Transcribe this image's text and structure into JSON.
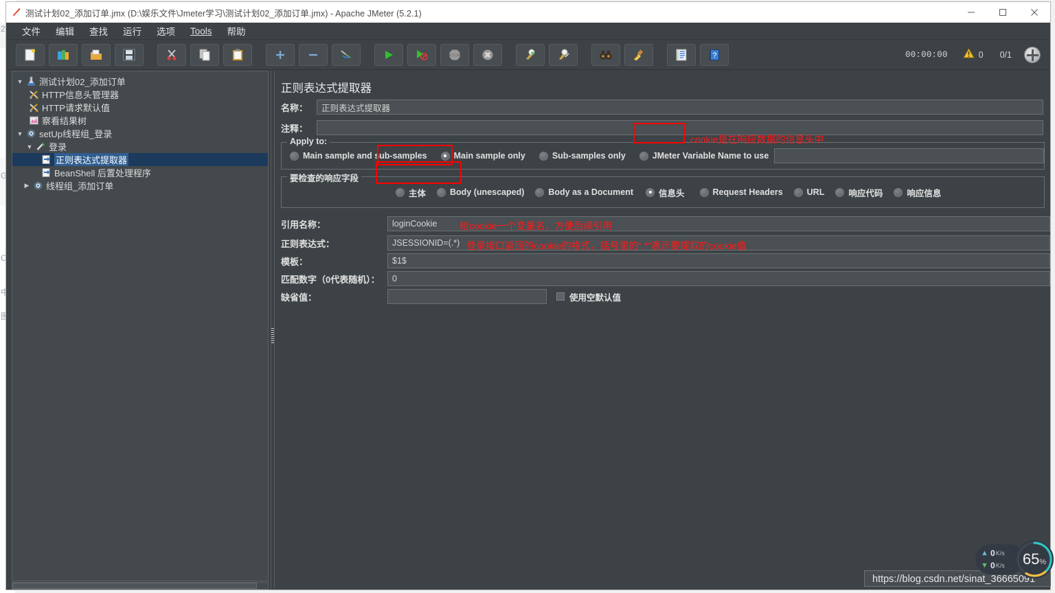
{
  "window": {
    "title": "测试计划02_添加订单.jmx (D:\\娱乐文件\\Jmeter学习\\测试计划02_添加订单.jmx) - Apache JMeter (5.2.1)",
    "app_icon": "jmeter-feather-icon",
    "minimize": "—",
    "maximize": "▢",
    "close": "✕"
  },
  "menubar": {
    "items": [
      {
        "label": "文件",
        "name": "menu-file"
      },
      {
        "label": "编辑",
        "name": "menu-edit"
      },
      {
        "label": "查找",
        "name": "menu-search"
      },
      {
        "label": "运行",
        "name": "menu-run"
      },
      {
        "label": "选项",
        "name": "menu-options"
      },
      {
        "label": "Tools",
        "name": "menu-tools"
      },
      {
        "label": "帮助",
        "name": "menu-help"
      }
    ]
  },
  "toolbar": {
    "buttons": [
      {
        "name": "new-button",
        "icon": "new-document-icon",
        "glyph": "🗋"
      },
      {
        "name": "templates-button",
        "icon": "templates-books-icon",
        "glyph": "📚"
      },
      {
        "name": "open-button",
        "icon": "open-folder-icon",
        "glyph": "📂"
      },
      {
        "name": "save-button",
        "icon": "save-floppy-icon",
        "glyph": "💾"
      },
      {
        "name": "cut-button",
        "icon": "scissors-icon",
        "glyph": "✂"
      },
      {
        "name": "copy-button",
        "icon": "copy-pages-icon",
        "glyph": "🗐"
      },
      {
        "name": "paste-button",
        "icon": "clipboard-icon",
        "glyph": "📋"
      },
      {
        "name": "expand-all-button",
        "icon": "plus-icon",
        "glyph": "+"
      },
      {
        "name": "collapse-all-button",
        "icon": "minus-icon",
        "glyph": "−"
      },
      {
        "name": "toggle-button",
        "icon": "toggle-pencils-icon",
        "glyph": "✎"
      },
      {
        "name": "start-button",
        "icon": "play-green-icon",
        "glyph": "▶"
      },
      {
        "name": "start-no-pauses-button",
        "icon": "play-no-pause-icon",
        "glyph": "▶"
      },
      {
        "name": "stop-button",
        "icon": "stop-sign-icon",
        "glyph": "⬣"
      },
      {
        "name": "shutdown-button",
        "icon": "shutdown-x-icon",
        "glyph": "✖"
      },
      {
        "name": "clear-button",
        "icon": "clear-broom-green-icon",
        "glyph": "🧹"
      },
      {
        "name": "clear-all-button",
        "icon": "clear-all-broom-icon",
        "glyph": "🧹"
      },
      {
        "name": "search-button",
        "icon": "binoculars-icon",
        "glyph": "🔭"
      },
      {
        "name": "reset-search-button",
        "icon": "broom-yellow-icon",
        "glyph": "🧹"
      },
      {
        "name": "function-helper-button",
        "icon": "notebook-list-icon",
        "glyph": "▤"
      },
      {
        "name": "help-button",
        "icon": "help-book-icon",
        "glyph": "?"
      }
    ],
    "status": {
      "elapsed": "00:00:00",
      "warning_icon": "warning-triangle-icon",
      "warning_count": "0",
      "threads": "0/1",
      "remote_icon": "remote-engines-icon"
    }
  },
  "tree": {
    "nodes": [
      {
        "label": "测试计划02_添加订单",
        "icon": "test-plan-flask-icon",
        "indent": 0,
        "twisty": "▼",
        "selected": false,
        "name": "tree-node-test-plan"
      },
      {
        "label": "HTTP信息头管理器",
        "icon": "header-manager-icon",
        "indent": 1,
        "twisty": "",
        "selected": false,
        "name": "tree-node-http-header-manager"
      },
      {
        "label": "HTTP请求默认值",
        "icon": "http-defaults-icon",
        "indent": 1,
        "twisty": "",
        "selected": false,
        "name": "tree-node-http-defaults"
      },
      {
        "label": "察看结果树",
        "icon": "view-results-tree-icon",
        "indent": 1,
        "twisty": "",
        "selected": false,
        "name": "tree-node-view-results-tree"
      },
      {
        "label": "setUp线程组_登录",
        "icon": "thread-group-gear-icon",
        "indent": 0,
        "twisty": "▼",
        "selected": false,
        "name": "tree-node-setup-thread-group"
      },
      {
        "label": "登录",
        "icon": "http-sampler-icon",
        "indent": 1,
        "twisty": "▼",
        "selected": false,
        "name": "tree-node-login-sampler"
      },
      {
        "label": "正则表达式提取器",
        "icon": "post-processor-icon",
        "indent": 2,
        "twisty": "",
        "selected": true,
        "name": "tree-node-regex-extractor"
      },
      {
        "label": "BeanShell 后置处理程序",
        "icon": "post-processor-icon",
        "indent": 2,
        "twisty": "",
        "selected": false,
        "name": "tree-node-beanshell-postprocessor"
      },
      {
        "label": "线程组_添加订单",
        "icon": "thread-group-gear-icon",
        "indent": 0,
        "twisty": "▶",
        "selected": false,
        "name": "tree-node-thread-group-add-order"
      }
    ]
  },
  "editor": {
    "title": "正则表达式提取器",
    "name_label": "名称：",
    "name_value": "正则表达式提取器",
    "comment_label": "注释：",
    "comment_value": "",
    "apply_to": {
      "title": "Apply to:",
      "options": [
        {
          "label": "Main sample and sub-samples",
          "selected": false,
          "name": "radio-main-and-sub"
        },
        {
          "label": "Main sample only",
          "selected": true,
          "name": "radio-main-only"
        },
        {
          "label": "Sub-samples only",
          "selected": false,
          "name": "radio-sub-only"
        },
        {
          "label": "JMeter Variable Name to use",
          "selected": false,
          "name": "radio-jmeter-variable"
        }
      ],
      "variable_value": ""
    },
    "response_field": {
      "title": "要检查的响应字段",
      "options": [
        {
          "label": "主体",
          "selected": false,
          "name": "radio-body"
        },
        {
          "label": "Body (unescaped)",
          "selected": false,
          "name": "radio-body-unescaped"
        },
        {
          "label": "Body as a Document",
          "selected": false,
          "name": "radio-body-document"
        },
        {
          "label": "信息头",
          "selected": true,
          "name": "radio-headers"
        },
        {
          "label": "Request Headers",
          "selected": false,
          "name": "radio-request-headers"
        },
        {
          "label": "URL",
          "selected": false,
          "name": "radio-url"
        },
        {
          "label": "响应代码",
          "selected": false,
          "name": "radio-response-code"
        },
        {
          "label": "响应信息",
          "selected": false,
          "name": "radio-response-message"
        }
      ]
    },
    "fields": [
      {
        "label": "引用名称：",
        "value": "loginCookie",
        "name": "reference-name-input"
      },
      {
        "label": "正则表达式：",
        "value": "JSESSIONID=(.*)",
        "name": "regex-input"
      },
      {
        "label": "模板：",
        "value": "$1$",
        "name": "template-input"
      },
      {
        "label": "匹配数字（0代表随机）：",
        "value": "0",
        "name": "match-number-input"
      }
    ],
    "default_value": {
      "label": "缺省值：",
      "value": "",
      "name": "default-value-input",
      "checkbox_label": "使用空默认值",
      "checkbox_checked": false
    }
  },
  "annotations": [
    {
      "text": "cookie是在响应数据的信息头中",
      "name": "annotation-headers-note"
    },
    {
      "text": "给cookie一个变量名，方便后续引用",
      "name": "annotation-reference-name-note"
    },
    {
      "text": "登录接口返回的cookie的格式，括号里的“.*”表示要提取的cookie值",
      "name": "annotation-regex-note"
    }
  ],
  "net_widget": {
    "upload": "0",
    "upload_unit": "K/s",
    "download": "0",
    "download_unit": "K/s",
    "gauge_value": "65",
    "gauge_unit": "%"
  },
  "watermark": "https://blog.csdn.net/sinat_36665091",
  "background_ghost": [
    "2",
    "G",
    "C",
    "中",
    "图"
  ]
}
